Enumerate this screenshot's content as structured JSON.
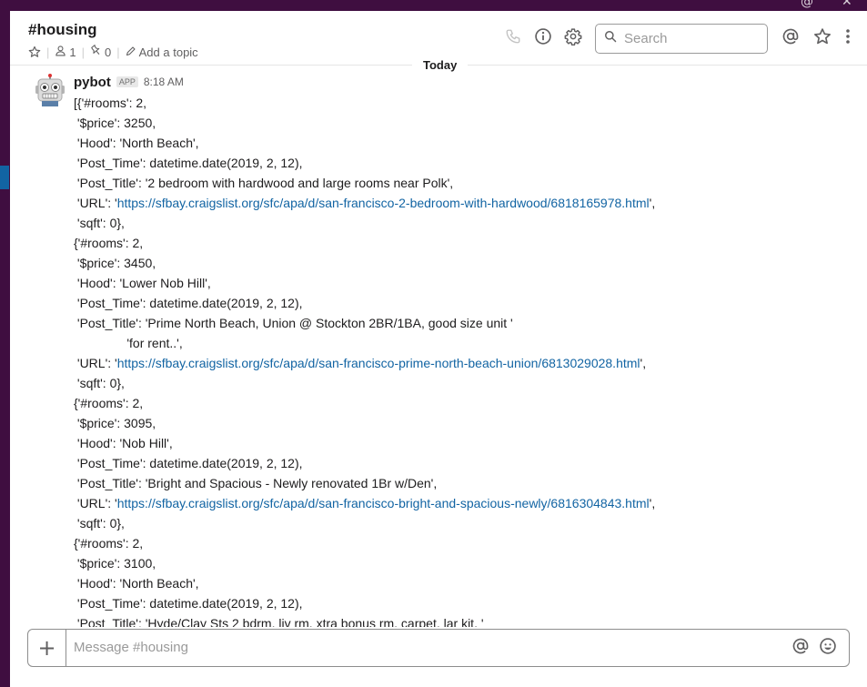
{
  "channel": {
    "name": "#housing",
    "member_count": "1",
    "pinned_count": "0",
    "add_topic": "Add a topic"
  },
  "search": {
    "placeholder": "Search"
  },
  "divider": {
    "label": "Today"
  },
  "message": {
    "sender": "pybot",
    "badge": "APP",
    "time": "8:18 AM",
    "lines": [
      {
        "pre": "[{'#rooms': 2,"
      },
      {
        "pre": " '$price': 3250,"
      },
      {
        "pre": " 'Hood': 'North Beach',"
      },
      {
        "pre": " 'Post_Time': datetime.date(2019, 2, 12),"
      },
      {
        "pre": " 'Post_Title': '2 bedroom with hardwood and large rooms near Polk',"
      },
      {
        "pre": " 'URL': '",
        "link": "https://sfbay.craigslist.org/sfc/apa/d/san-francisco-2-bedroom-with-hardwood/6818165978.html",
        "post": "',"
      },
      {
        "pre": " 'sqft': 0},"
      },
      {
        "pre": "{'#rooms': 2,"
      },
      {
        "pre": " '$price': 3450,"
      },
      {
        "pre": " 'Hood': 'Lower Nob Hill',"
      },
      {
        "pre": " 'Post_Time': datetime.date(2019, 2, 12),"
      },
      {
        "pre": " 'Post_Title': 'Prime North Beach, Union @ Stockton 2BR/1BA, good size unit '"
      },
      {
        "pre": "               'for rent..',"
      },
      {
        "pre": " 'URL': '",
        "link": "https://sfbay.craigslist.org/sfc/apa/d/san-francisco-prime-north-beach-union/6813029028.html",
        "post": "',"
      },
      {
        "pre": " 'sqft': 0},"
      },
      {
        "pre": "{'#rooms': 2,"
      },
      {
        "pre": " '$price': 3095,"
      },
      {
        "pre": " 'Hood': 'Nob Hill',"
      },
      {
        "pre": " 'Post_Time': datetime.date(2019, 2, 12),"
      },
      {
        "pre": " 'Post_Title': 'Bright and Spacious - Newly renovated 1Br w/Den',"
      },
      {
        "pre": " 'URL': '",
        "link": "https://sfbay.craigslist.org/sfc/apa/d/san-francisco-bright-and-spacious-newly/6816304843.html",
        "post": "',"
      },
      {
        "pre": " 'sqft': 0},"
      },
      {
        "pre": "{'#rooms': 2,"
      },
      {
        "pre": " '$price': 3100,"
      },
      {
        "pre": " 'Hood': 'North Beach',"
      },
      {
        "pre": " 'Post_Time': datetime.date(2019, 2, 12),"
      },
      {
        "pre": " 'Post_Title': 'Hyde/Clay Sts 2 bdrm, liv rm, xtra bonus rm, carpet, lar kit, '"
      }
    ]
  },
  "composer": {
    "placeholder": "Message #housing"
  },
  "icons": {
    "star": "star-icon",
    "members": "person-icon",
    "pins": "pin-icon",
    "topic": "pencil-icon",
    "call": "phone-icon",
    "info": "info-icon",
    "settings": "gear-icon",
    "search": "search-icon",
    "mentions": "at-icon",
    "starred": "star-icon",
    "more": "more-vertical-icon",
    "attach": "plus-icon",
    "emoji": "emoji-icon"
  },
  "colors": {
    "sidebar": "#3f0e40",
    "link": "#1264a3",
    "active": "#1264a3"
  }
}
